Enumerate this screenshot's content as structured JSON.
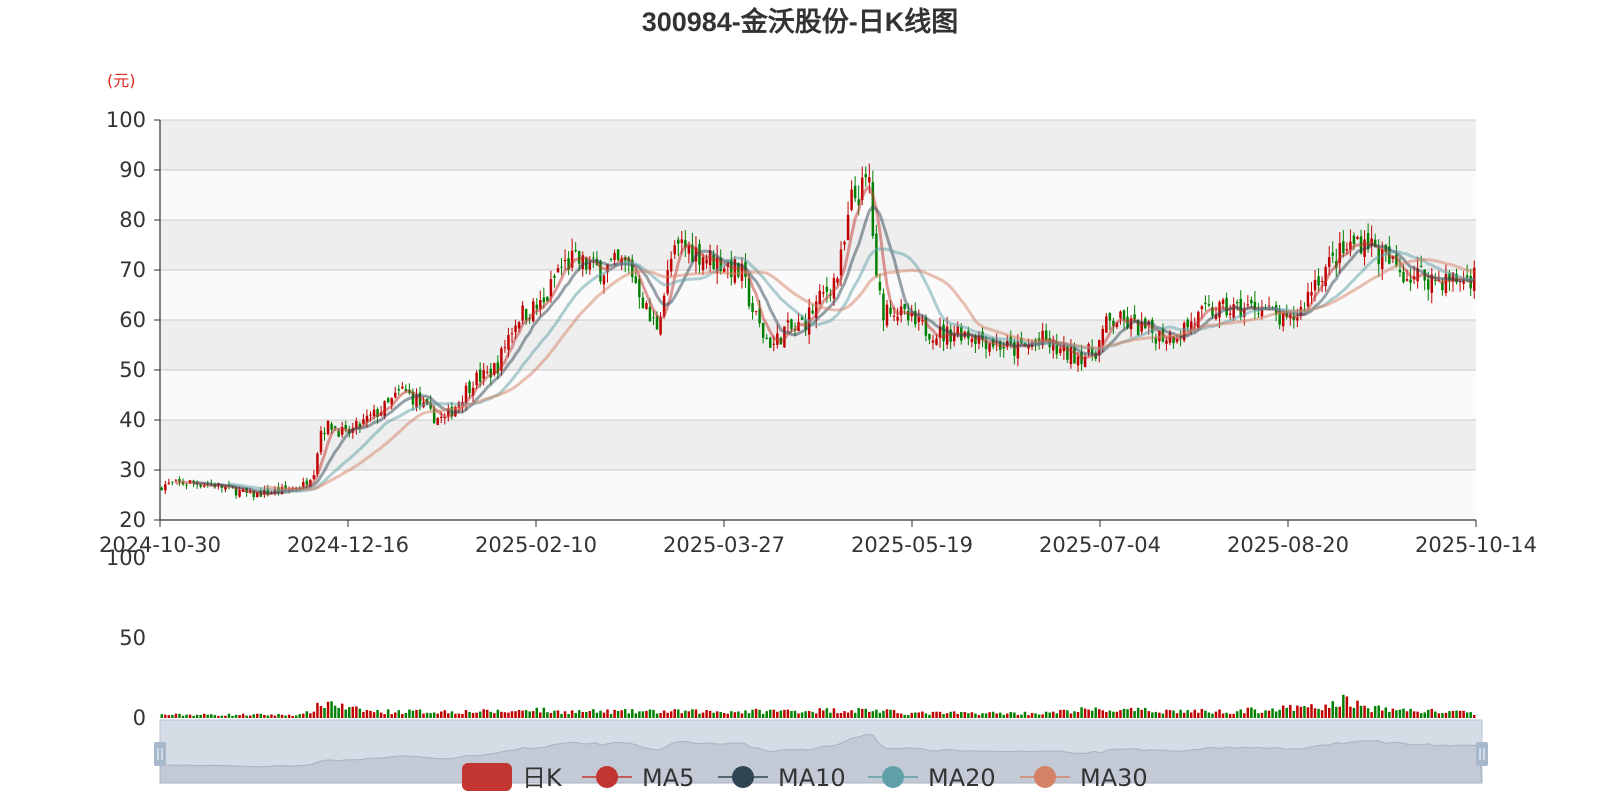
{
  "title": "300984-金沃股份-日K线图",
  "chart_data": {
    "type": "candlestick",
    "title": "300984-金沃股份-日K线图",
    "unit_label": "(元)",
    "price_axis": {
      "ylim": [
        20,
        100
      ],
      "ticks": [
        "20",
        "30",
        "40",
        "50",
        "60",
        "70",
        "80",
        "90",
        "100"
      ]
    },
    "volume_axis": {
      "ylim": [
        0,
        100
      ],
      "ticks": [
        "0",
        "50",
        "100"
      ]
    },
    "x_tick_labels": [
      "2024-10-30",
      "2024-12-16",
      "2025-02-10",
      "2025-03-27",
      "2025-05-19",
      "2025-07-04",
      "2025-08-20",
      "2025-10-14"
    ],
    "date_range": [
      "2024-10-30",
      "2025-10-14"
    ],
    "grid": true,
    "legend_position": "bottom-center",
    "legend": [
      {
        "name": "日K",
        "color": "#c23531",
        "kind": "box"
      },
      {
        "name": "MA5",
        "color": "#c23531",
        "kind": "line"
      },
      {
        "name": "MA10",
        "color": "#2f4554",
        "kind": "line"
      },
      {
        "name": "MA20",
        "color": "#61a0a8",
        "kind": "line"
      },
      {
        "name": "MA30",
        "color": "#d48265",
        "kind": "line"
      }
    ],
    "colors": {
      "up": "#c00000",
      "down": "#008000",
      "band": "#eeeeee",
      "grid": "#cccccc"
    },
    "close_anchors": [
      [
        0,
        27
      ],
      [
        8,
        27.5
      ],
      [
        15,
        27
      ],
      [
        20,
        26
      ],
      [
        25,
        25
      ],
      [
        30,
        25.5
      ],
      [
        35,
        26
      ],
      [
        40,
        27
      ],
      [
        43,
        30
      ],
      [
        45,
        38
      ],
      [
        48,
        39
      ],
      [
        52,
        37
      ],
      [
        56,
        39
      ],
      [
        60,
        41
      ],
      [
        64,
        43
      ],
      [
        68,
        46
      ],
      [
        72,
        44
      ],
      [
        76,
        41
      ],
      [
        80,
        40
      ],
      [
        84,
        44
      ],
      [
        88,
        48
      ],
      [
        92,
        49
      ],
      [
        95,
        51
      ],
      [
        98,
        57
      ],
      [
        101,
        61
      ],
      [
        104,
        62
      ],
      [
        108,
        63
      ],
      [
        112,
        70
      ],
      [
        116,
        72
      ],
      [
        120,
        71
      ],
      [
        124,
        70
      ],
      [
        128,
        71
      ],
      [
        132,
        71
      ],
      [
        135,
        66
      ],
      [
        138,
        60
      ],
      [
        140,
        59
      ],
      [
        144,
        72
      ],
      [
        147,
        75
      ],
      [
        150,
        74
      ],
      [
        153,
        73
      ],
      [
        156,
        72
      ],
      [
        160,
        71
      ],
      [
        164,
        69
      ],
      [
        167,
        62
      ],
      [
        170,
        57
      ],
      [
        173,
        55
      ],
      [
        176,
        58
      ],
      [
        179,
        58
      ],
      [
        182,
        60
      ],
      [
        185,
        63
      ],
      [
        188,
        66
      ],
      [
        191,
        69
      ],
      [
        193,
        75
      ],
      [
        195,
        84
      ],
      [
        198,
        86
      ],
      [
        200,
        88
      ],
      [
        202,
        67
      ],
      [
        204,
        62
      ],
      [
        206,
        63
      ],
      [
        209,
        61
      ],
      [
        213,
        59
      ],
      [
        217,
        58
      ],
      [
        221,
        57
      ],
      [
        225,
        58
      ],
      [
        229,
        57
      ],
      [
        233,
        56
      ],
      [
        237,
        55
      ],
      [
        241,
        54
      ],
      [
        245,
        55
      ],
      [
        249,
        56
      ],
      [
        253,
        54
      ],
      [
        257,
        53
      ],
      [
        261,
        53
      ],
      [
        264,
        54
      ],
      [
        267,
        59
      ],
      [
        270,
        60
      ],
      [
        274,
        59
      ],
      [
        278,
        58
      ],
      [
        282,
        57
      ],
      [
        286,
        57
      ],
      [
        290,
        59
      ],
      [
        294,
        61
      ],
      [
        298,
        62
      ],
      [
        302,
        62
      ],
      [
        306,
        62
      ],
      [
        310,
        63
      ],
      [
        314,
        61
      ],
      [
        318,
        59
      ],
      [
        322,
        62
      ],
      [
        326,
        68
      ],
      [
        330,
        71
      ],
      [
        333,
        73
      ],
      [
        335,
        74
      ],
      [
        338,
        76
      ],
      [
        341,
        76
      ],
      [
        344,
        73
      ],
      [
        348,
        71
      ],
      [
        352,
        69
      ],
      [
        356,
        69
      ],
      [
        360,
        68
      ],
      [
        364,
        68
      ],
      [
        368,
        68
      ],
      [
        371,
        69
      ]
    ],
    "volume_profile": [
      [
        0,
        2
      ],
      [
        40,
        2
      ],
      [
        45,
        8
      ],
      [
        48,
        10
      ],
      [
        52,
        6
      ],
      [
        60,
        4
      ],
      [
        100,
        4
      ],
      [
        104,
        6
      ],
      [
        110,
        4
      ],
      [
        160,
        4
      ],
      [
        200,
        5
      ],
      [
        210,
        3
      ],
      [
        250,
        3
      ],
      [
        260,
        5
      ],
      [
        300,
        4
      ],
      [
        330,
        7
      ],
      [
        335,
        12
      ],
      [
        340,
        6
      ],
      [
        371,
        3
      ]
    ],
    "moving_averages": [
      {
        "name": "MA5",
        "period": 5
      },
      {
        "name": "MA10",
        "period": 10
      },
      {
        "name": "MA20",
        "period": 20
      },
      {
        "name": "MA30",
        "period": 30
      }
    ]
  }
}
